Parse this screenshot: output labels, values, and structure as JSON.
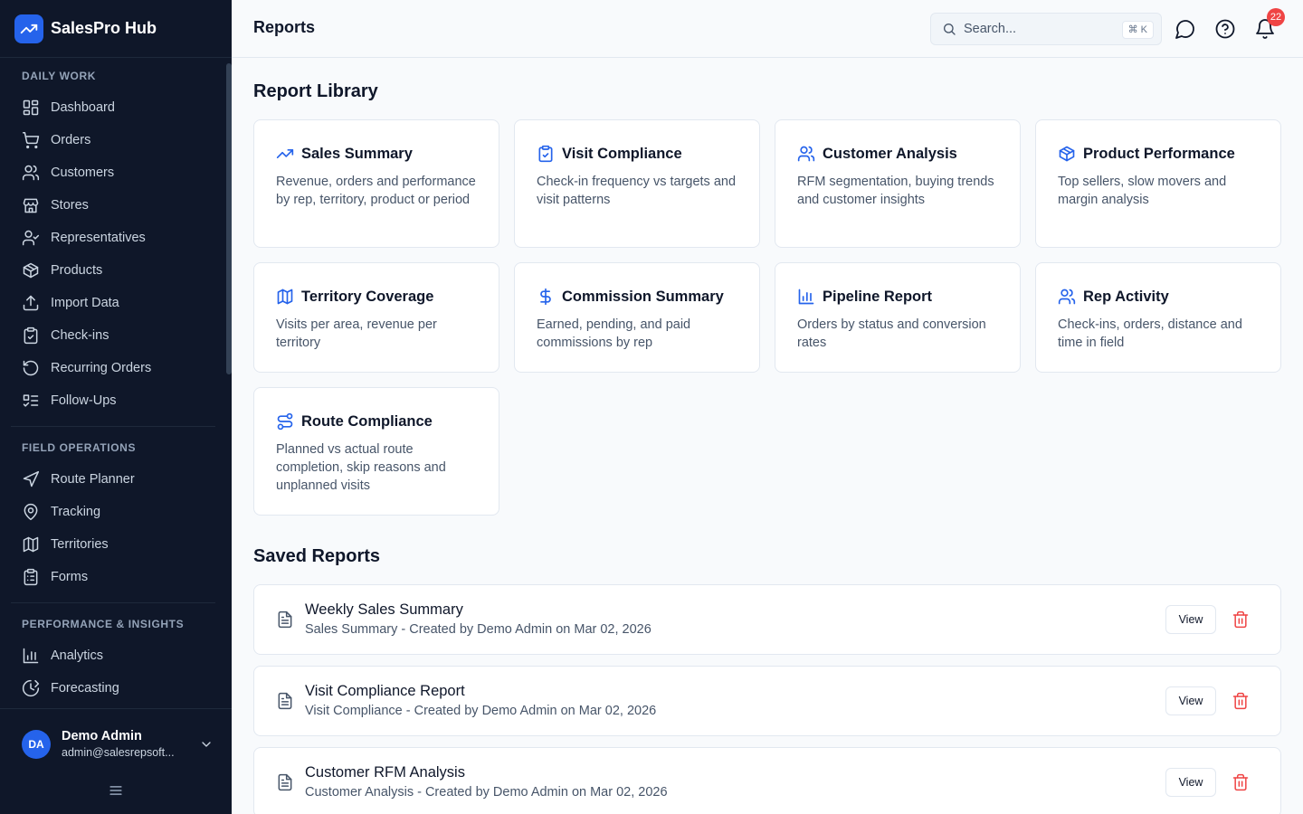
{
  "app": {
    "name": "SalesPro Hub"
  },
  "sidebar": {
    "sections": [
      {
        "title": "DAILY WORK",
        "items": [
          {
            "label": "Dashboard",
            "icon": "dashboard-icon"
          },
          {
            "label": "Orders",
            "icon": "cart-icon"
          },
          {
            "label": "Customers",
            "icon": "users-icon"
          },
          {
            "label": "Stores",
            "icon": "store-icon"
          },
          {
            "label": "Representatives",
            "icon": "user-check-icon"
          },
          {
            "label": "Products",
            "icon": "package-icon"
          },
          {
            "label": "Import Data",
            "icon": "upload-icon"
          },
          {
            "label": "Check-ins",
            "icon": "clipboard-check-icon"
          },
          {
            "label": "Recurring Orders",
            "icon": "refresh-icon"
          },
          {
            "label": "Follow-Ups",
            "icon": "list-checks-icon"
          }
        ]
      },
      {
        "title": "FIELD OPERATIONS",
        "items": [
          {
            "label": "Route Planner",
            "icon": "navigation-icon"
          },
          {
            "label": "Tracking",
            "icon": "map-pin-icon"
          },
          {
            "label": "Territories",
            "icon": "map-icon"
          },
          {
            "label": "Forms",
            "icon": "clipboard-list-icon"
          }
        ]
      },
      {
        "title": "PERFORMANCE & INSIGHTS",
        "items": [
          {
            "label": "Analytics",
            "icon": "bar-chart-icon"
          },
          {
            "label": "Forecasting",
            "icon": "forecast-icon"
          }
        ]
      }
    ],
    "user": {
      "initials": "DA",
      "name": "Demo Admin",
      "email": "admin@salesrepsoft..."
    }
  },
  "header": {
    "title": "Reports",
    "search_placeholder": "Search...",
    "search_shortcut": "⌘ K",
    "notification_count": "22"
  },
  "library": {
    "title": "Report Library",
    "cards": [
      {
        "title": "Sales Summary",
        "description": "Revenue, orders and performance by rep, territory, product or period",
        "icon": "trending-up-icon"
      },
      {
        "title": "Visit Compliance",
        "description": "Check-in frequency vs targets and visit patterns",
        "icon": "clipboard-check-icon"
      },
      {
        "title": "Customer Analysis",
        "description": "RFM segmentation, buying trends and customer insights",
        "icon": "users-icon"
      },
      {
        "title": "Product Performance",
        "description": "Top sellers, slow movers and margin analysis",
        "icon": "package-icon"
      },
      {
        "title": "Territory Coverage",
        "description": "Visits per area, revenue per territory",
        "icon": "map-icon"
      },
      {
        "title": "Commission Summary",
        "description": "Earned, pending, and paid commissions by rep",
        "icon": "dollar-icon"
      },
      {
        "title": "Pipeline Report",
        "description": "Orders by status and conversion rates",
        "icon": "bar-chart-icon"
      },
      {
        "title": "Rep Activity",
        "description": "Check-ins, orders, distance and time in field",
        "icon": "users-icon"
      },
      {
        "title": "Route Compliance",
        "description": "Planned vs actual route completion, skip reasons and unplanned visits",
        "icon": "route-icon"
      }
    ]
  },
  "saved": {
    "title": "Saved Reports",
    "view_label": "View",
    "items": [
      {
        "title": "Weekly Sales Summary",
        "subtitle": "Sales Summary - Created by Demo Admin on Mar 02, 2026"
      },
      {
        "title": "Visit Compliance Report",
        "subtitle": "Visit Compliance - Created by Demo Admin on Mar 02, 2026"
      },
      {
        "title": "Customer RFM Analysis",
        "subtitle": "Customer Analysis - Created by Demo Admin on Mar 02, 2026"
      }
    ]
  },
  "colors": {
    "accent": "#2563eb",
    "sidebar_bg": "#0f1729",
    "danger": "#ef4444"
  }
}
